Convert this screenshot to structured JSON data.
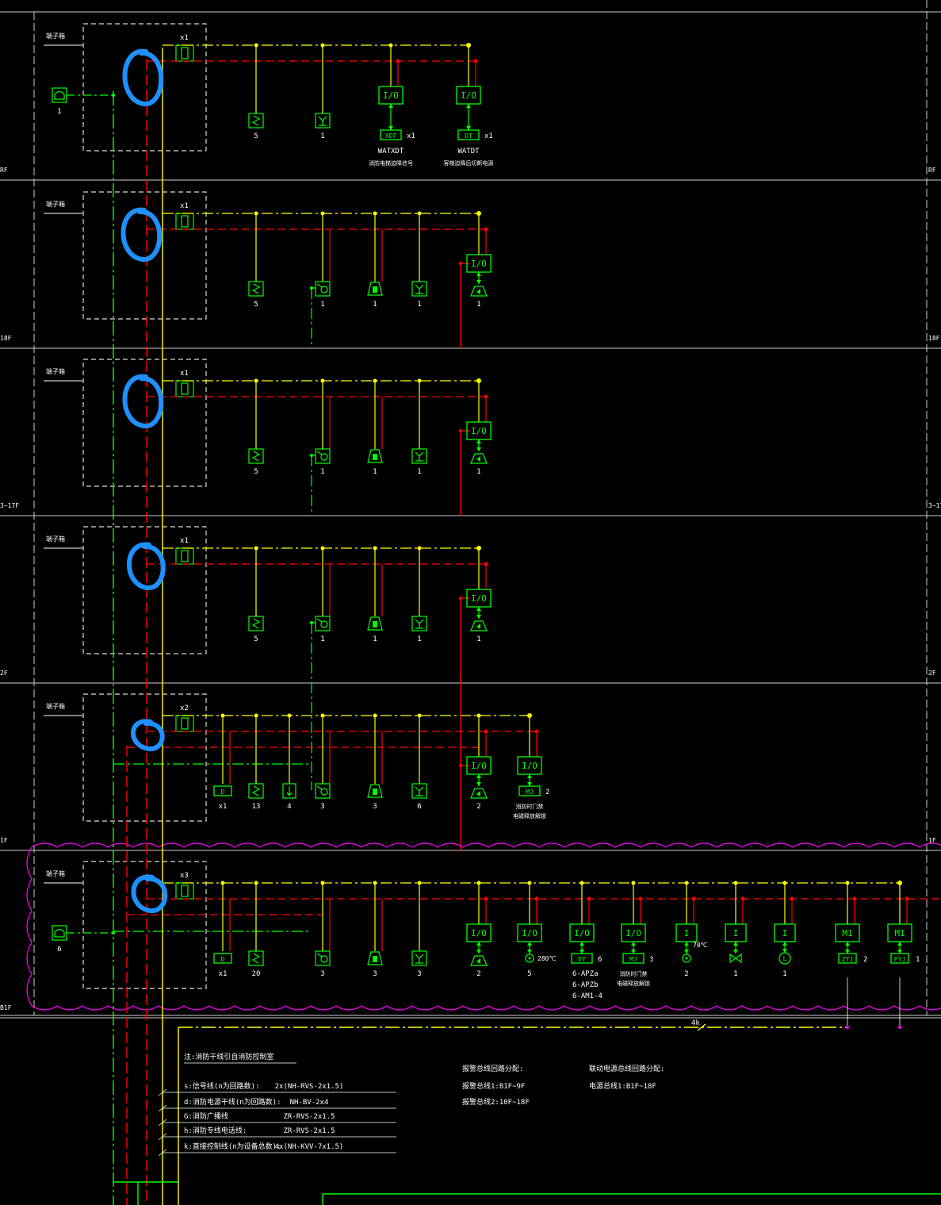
{
  "colors": {
    "background": "#000000",
    "frame": "#ffffff",
    "signal_line": "#ffff00",
    "power_line": "#ff0000",
    "broadcast_line": "#00ff00",
    "device": "#00ff00",
    "text": "#ffffff",
    "revision_cloud": "#ff00ff",
    "annotation": "#1e90ff",
    "label_yellow": "#ffff00"
  },
  "floors": [
    {
      "label": "RF",
      "label_right": "RF",
      "terminal_label": "端子箱",
      "bus_label": "x1",
      "devices": [
        {
          "kind": "smoke",
          "count": "5"
        },
        {
          "kind": "heat",
          "count": "1"
        },
        {
          "kind": "io",
          "box": "I/O",
          "sub": "XDT",
          "sub_count": "x1",
          "name": "WATXDT",
          "desc": "消防电梯迫降信号"
        },
        {
          "kind": "io",
          "box": "I/O",
          "sub": "DT",
          "sub_count": "x1",
          "name": "WATDT",
          "desc": "客梯迫降后切断电源"
        }
      ],
      "left_device": {
        "kind": "phone",
        "count": "1"
      }
    },
    {
      "label": "18F",
      "label_right": "18F",
      "terminal_label": "端子箱",
      "bus_label": "x1",
      "devices": [
        {
          "kind": "smoke",
          "count": "5"
        },
        {
          "kind": "hydrant",
          "count": "1"
        },
        {
          "kind": "alarm",
          "count": "1"
        },
        {
          "kind": "heat",
          "count": "1"
        },
        {
          "kind": "io_speaker",
          "box": "I/O",
          "count": "1"
        }
      ]
    },
    {
      "label": "3~17F",
      "label_right": "3~17F",
      "terminal_label": "端子箱",
      "bus_label": "x1",
      "devices": [
        {
          "kind": "smoke",
          "count": "5"
        },
        {
          "kind": "hydrant",
          "count": "1"
        },
        {
          "kind": "alarm",
          "count": "1"
        },
        {
          "kind": "heat",
          "count": "1"
        },
        {
          "kind": "io_speaker",
          "box": "I/O",
          "count": "1"
        }
      ]
    },
    {
      "label": "2F",
      "label_right": "2F",
      "terminal_label": "端子箱",
      "bus_label": "x1",
      "devices": [
        {
          "kind": "smoke",
          "count": "5"
        },
        {
          "kind": "hydrant",
          "count": "1"
        },
        {
          "kind": "alarm",
          "count": "1"
        },
        {
          "kind": "heat",
          "count": "1"
        },
        {
          "kind": "io_speaker",
          "box": "I/O",
          "count": "1"
        }
      ]
    },
    {
      "label": "1F",
      "label_right": "1F",
      "terminal_label": "端子箱",
      "bus_label": "x2",
      "devices": [
        {
          "kind": "display",
          "count": "x1",
          "mark": "D"
        },
        {
          "kind": "smoke",
          "count": "13"
        },
        {
          "kind": "speaker_down",
          "count": "4"
        },
        {
          "kind": "hydrant",
          "count": "3"
        },
        {
          "kind": "alarm",
          "count": "3"
        },
        {
          "kind": "heat",
          "count": "6"
        },
        {
          "kind": "io_speaker",
          "box": "I/O",
          "count": "2"
        },
        {
          "kind": "io",
          "box": "I/O",
          "sub": "MJ",
          "sub_count": "2",
          "name": "",
          "desc": "消防时门禁",
          "desc2": "电磁释放解锁"
        }
      ]
    },
    {
      "label": "B1F",
      "label_right": "",
      "terminal_label": "端子箱",
      "bus_label": "x3",
      "devices": [
        {
          "kind": "display",
          "count": "x1",
          "mark": "D"
        },
        {
          "kind": "smoke",
          "count": "20"
        },
        {
          "kind": "hydrant",
          "count": "3"
        },
        {
          "kind": "alarm",
          "count": "3"
        },
        {
          "kind": "heat",
          "count": "3"
        },
        {
          "kind": "io_speaker",
          "box": "I/O",
          "count": "2"
        },
        {
          "kind": "io_valve",
          "box": "I/O",
          "sub": "280℃",
          "count": "5"
        },
        {
          "kind": "io",
          "box": "I/O",
          "sub": "DY",
          "sub_count": "6",
          "lines": [
            "6-APZa",
            "6-APZb",
            "6-AM1-4"
          ]
        },
        {
          "kind": "io",
          "box": "I/O",
          "sub": "MJ",
          "sub_count": "3",
          "desc": "消防时门禁",
          "desc2": "电磁释放解锁"
        },
        {
          "kind": "input",
          "box": "I",
          "sub": "70℃",
          "count": "2"
        },
        {
          "kind": "input_valve",
          "box": "I",
          "count": "1"
        },
        {
          "kind": "input_flow",
          "box": "I",
          "sub": "L",
          "count": "1"
        },
        {
          "kind": "module",
          "box": "M1",
          "sub": "ZYJ",
          "sub_count": "2"
        },
        {
          "kind": "module",
          "box": "M1",
          "sub": "PYJ",
          "sub_count": "1"
        }
      ],
      "left_device": {
        "kind": "phone",
        "count": "6"
      }
    }
  ],
  "cable_4k": "4k",
  "legend": {
    "title": "注:消防干线引自消防控制室",
    "rows": [
      {
        "code": "s:信号线(n为回路数):",
        "spec": "2x(NH-RVS-2x1.5)"
      },
      {
        "code": "d:消防电源干线(n为回路数):",
        "spec": "NH-BV-2x4"
      },
      {
        "code": "G:消防广播线",
        "spec": "ZR-RVS-2x1.5"
      },
      {
        "code": "h:消防专线电话线:",
        "spec": "ZR-RVS-2x1.5"
      },
      {
        "code": "k:直接控制线(n为设备总数):",
        "spec": "4x(NH-KVV-7x1.5)"
      }
    ]
  },
  "loop_notes": [
    "报警总线回路分配:",
    "报警总线1:B1F~9F",
    "报警总线2:10F~18F"
  ],
  "power_notes": [
    "联动电源总线回路分配:",
    "电源总线1:B1F~18F"
  ]
}
